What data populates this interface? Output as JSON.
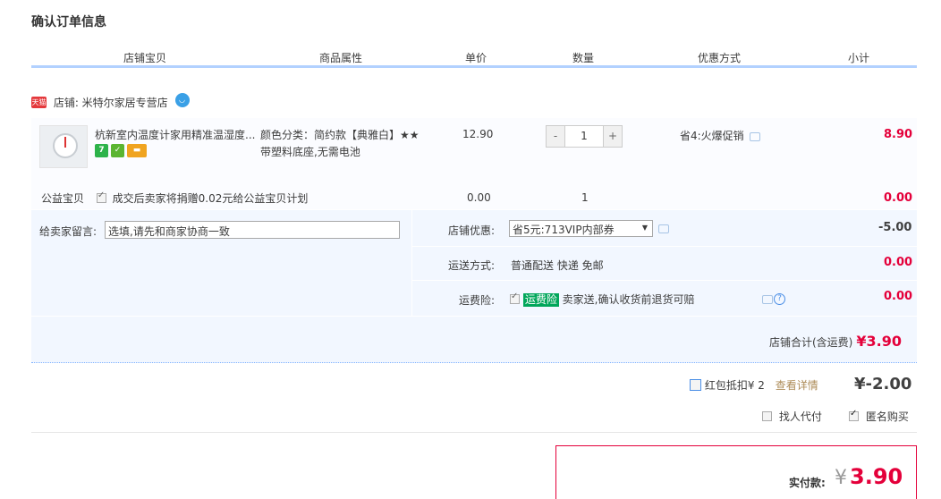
{
  "page": {
    "title": "确认订单信息"
  },
  "table_header": [
    "店铺宝贝",
    "商品属性",
    "单价",
    "数量",
    "优惠方式",
    "小计"
  ],
  "shop": {
    "badge": "天猫",
    "label": "店铺: 米特尔家居专营店"
  },
  "item": {
    "name": "杭新室内温度计家用精准温湿度...",
    "attr_line1": "颜色分类：简约款【典雅白】★★",
    "attr_line2": "带塑料底座,无需电池",
    "price": "12.90",
    "qty_minus": "-",
    "qty": "1",
    "qty_plus": "+",
    "promo": "省4:火爆促销",
    "subtotal": "8.90"
  },
  "welfare": {
    "label": "公益宝贝",
    "text": "成交后卖家将捐赠0.02元给公益宝贝计划",
    "price": "0.00",
    "qty": "1",
    "subtotal": "0.00"
  },
  "note": {
    "label": "给卖家留言:",
    "value": "选填,请先和商家协商一致"
  },
  "shop_discount": {
    "label": "店铺优惠:",
    "selected": "省5元:713VIP内部券",
    "amount": "-5.00"
  },
  "shipping": {
    "label": "运送方式:",
    "value": "普通配送 快递 免邮",
    "amount": "0.00"
  },
  "insurance": {
    "label": "运费险:",
    "tag": "运费险",
    "text": "卖家送,确认收货前退货可赔",
    "amount": "0.00"
  },
  "shop_total": {
    "label": "店铺合计(含运费)",
    "value": "¥3.90"
  },
  "redpacket": {
    "label": "红包抵扣¥ 2",
    "detail": "查看详情",
    "amount": "¥-2.00"
  },
  "options": {
    "proxy_pay": "找人代付",
    "anonymous": "匿名购买"
  },
  "payment": {
    "label": "实付款:",
    "currency": "¥",
    "value": "3.90"
  },
  "colors": {
    "accent_red": "#e4003a",
    "header_line": "#b2d1ff",
    "panel_bg": "#f2f7ff"
  }
}
